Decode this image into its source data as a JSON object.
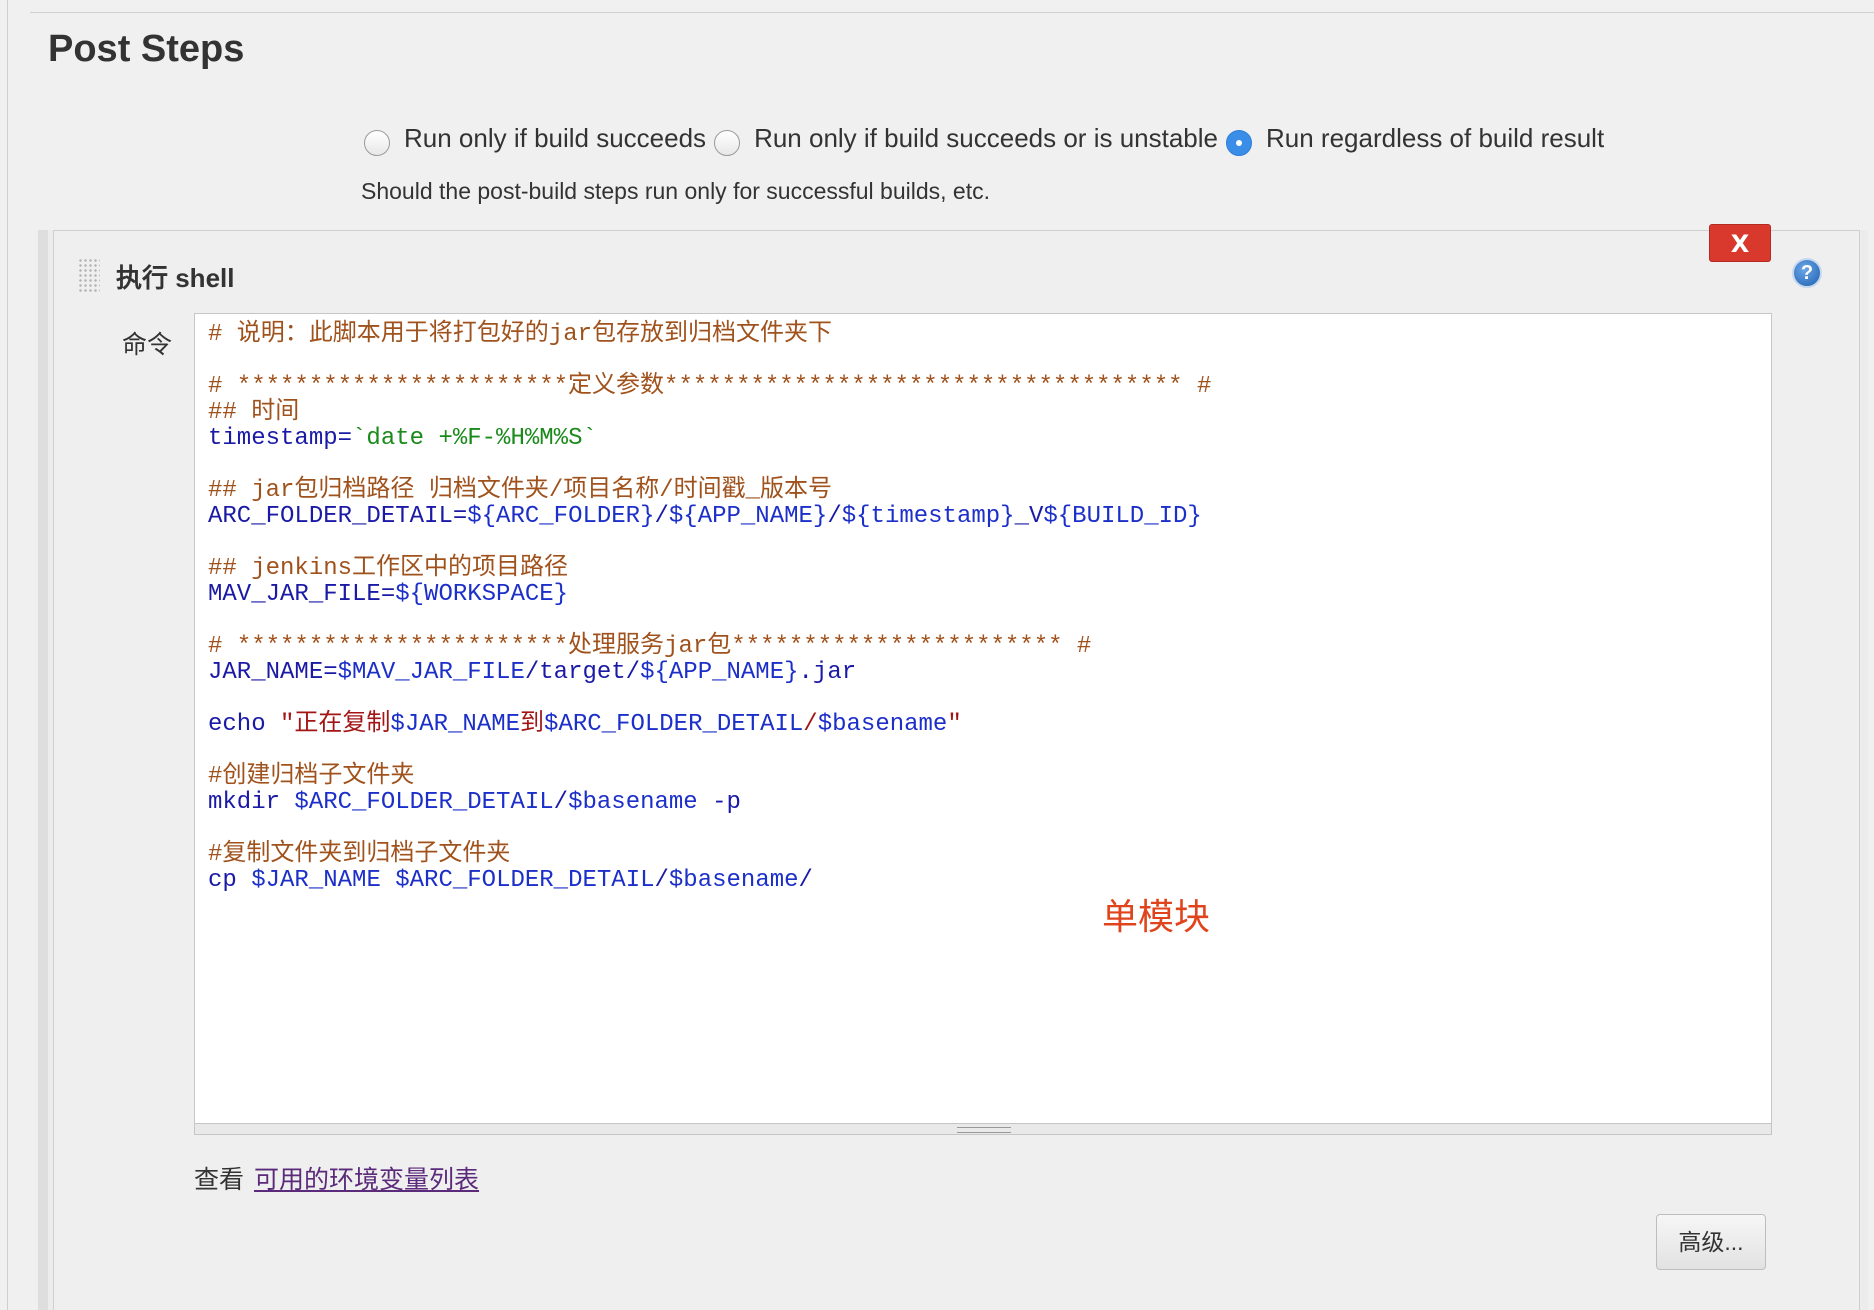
{
  "section": {
    "title": "Post Steps"
  },
  "run_options": {
    "options": [
      {
        "label": "Run only if build succeeds",
        "checked": false
      },
      {
        "label": "Run only if build succeeds or is unstable",
        "checked": false
      },
      {
        "label": "Run regardless of build result",
        "checked": true
      }
    ],
    "help_text": "Should the post-build steps run only for successful builds, etc."
  },
  "build_step": {
    "title": "执行 shell",
    "delete_label": "X",
    "help_icon": "?",
    "command_label": "命令",
    "command_lines": [
      "# 说明：此脚本用于将打包好的jar包存放到归档文件夹下",
      "",
      "# ***********************定义参数************************************ #",
      "## 时间",
      "timestamp=`date +%F-%H%M%S`",
      "",
      "## jar包归档路径 归档文件夹/项目名称/时间戳_版本号",
      "ARC_FOLDER_DETAIL=${ARC_FOLDER}/${APP_NAME}/${timestamp}_V${BUILD_ID}",
      "",
      "## jenkins工作区中的项目路径",
      "MAV_JAR_FILE=${WORKSPACE}",
      "",
      "# ***********************处理服务jar包*********************** #",
      "JAR_NAME=$MAV_JAR_FILE/target/${APP_NAME}.jar",
      "",
      "echo \"正在复制$JAR_NAME到$ARC_FOLDER_DETAIL/$basename\"",
      "",
      "#创建归档子文件夹",
      "mkdir $ARC_FOLDER_DETAIL/$basename -p",
      "",
      "#复制文件夹到归档子文件夹",
      "cp $JAR_NAME $ARC_FOLDER_DETAIL/$basename/"
    ],
    "annotation": "单模块",
    "env_prefix": "查看",
    "env_link": "可用的环境变量列表",
    "advanced_label": "高级..."
  }
}
